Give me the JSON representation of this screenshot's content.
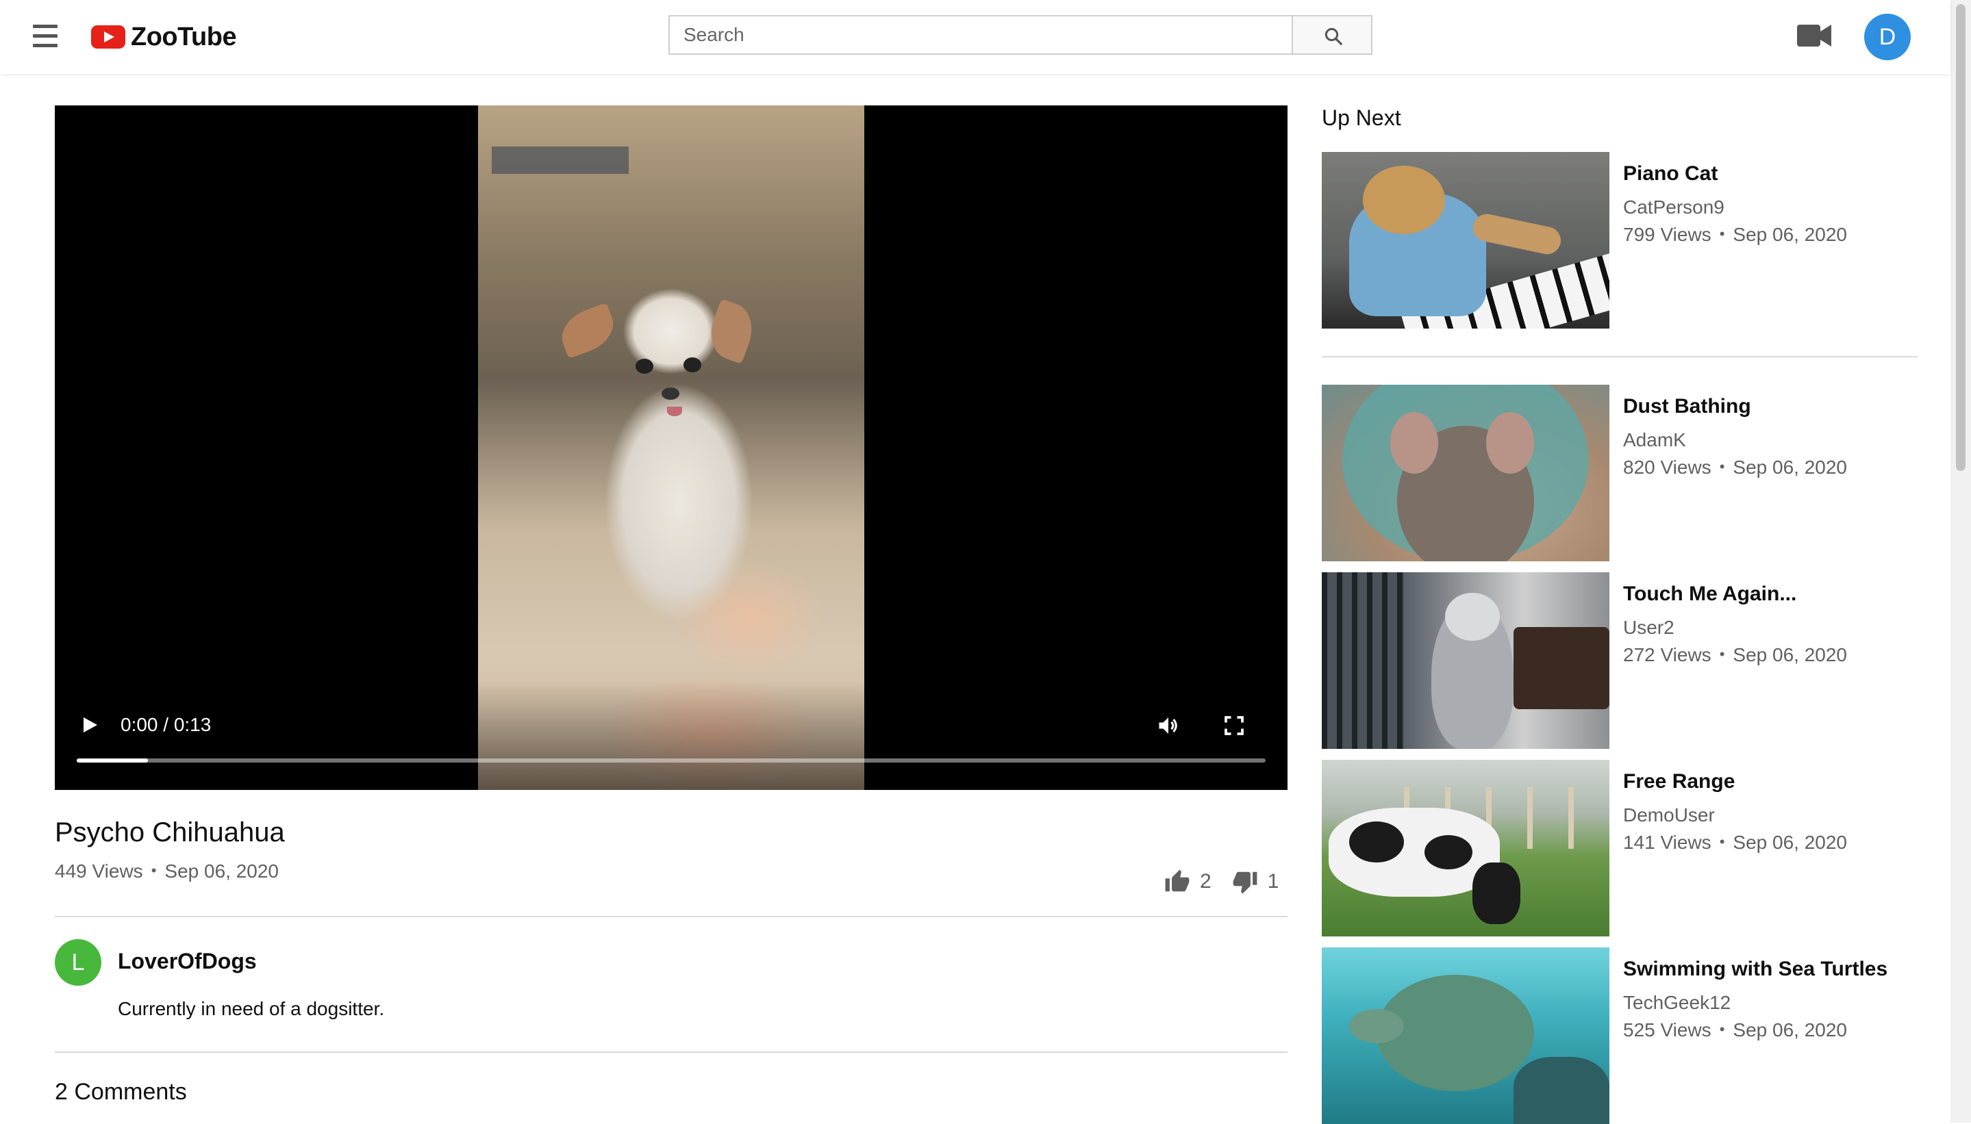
{
  "header": {
    "brand": "ZooTube",
    "search_placeholder": "Search",
    "user_initial": "D"
  },
  "player": {
    "time_current": "0:00",
    "time_total": "0:13",
    "time_label": "0:00 / 0:13",
    "progress_fraction": 0.06
  },
  "video": {
    "title": "Psycho Chihuahua",
    "views": "449 Views",
    "date": "Sep 06, 2020",
    "likes": "2",
    "dislikes": "1",
    "uploader_initial": "L",
    "uploader": "LoverOfDogs",
    "description": "Currently in need of a dogsitter.",
    "comments_count": "2 Comments"
  },
  "up_next": {
    "heading": "Up Next",
    "items": [
      {
        "title": "Piano Cat",
        "channel": "CatPerson9",
        "views": "799 Views",
        "date": "Sep 06, 2020"
      },
      {
        "title": "Dust Bathing",
        "channel": "AdamK",
        "views": "820 Views",
        "date": "Sep 06, 2020"
      },
      {
        "title": "Touch Me Again...",
        "channel": "User2",
        "views": "272 Views",
        "date": "Sep 06, 2020"
      },
      {
        "title": "Free Range",
        "channel": "DemoUser",
        "views": "141 Views",
        "date": "Sep 06, 2020"
      },
      {
        "title": "Swimming with Sea Turtles",
        "channel": "TechGeek12",
        "views": "525 Views",
        "date": "Sep 06, 2020"
      }
    ]
  },
  "colors": {
    "brand_red": "#e62117",
    "user_avatar": "#2f8fe0",
    "uploader_avatar": "#47b83c"
  }
}
